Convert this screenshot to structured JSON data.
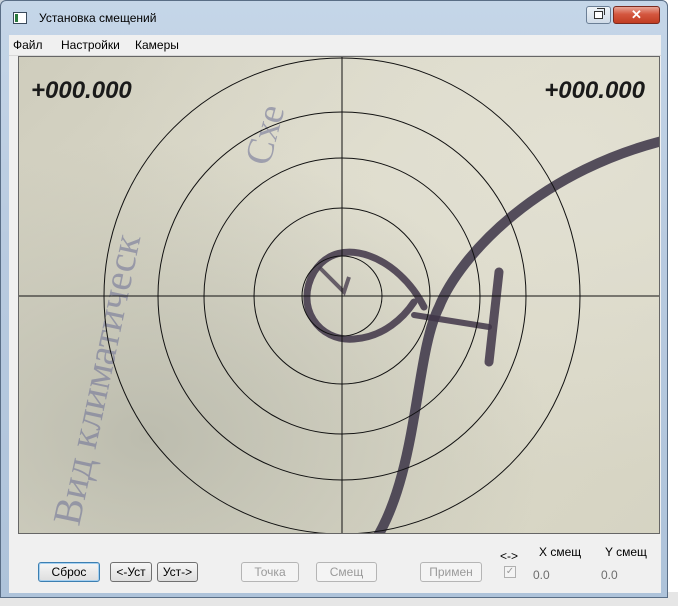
{
  "window": {
    "title": "Установка смещений",
    "close_glyph": "✕"
  },
  "menu": {
    "items": [
      "Файл",
      "Настройки",
      "Камеры"
    ]
  },
  "viewport": {
    "x_readout": "+000.000",
    "y_readout": "+000.000"
  },
  "controls": {
    "reset_label": "Сброс",
    "set_left_label": "<-Уст",
    "set_right_label": "Уст->",
    "point_label": "Точка",
    "offset_label": "Смещ",
    "apply_label": "Примен",
    "swap_label": "<->",
    "swap_checked": true,
    "x_offset_label": "X смещ",
    "y_offset_label": "Y смещ",
    "x_offset_value": "0.0",
    "y_offset_value": "0.0"
  },
  "icons": {
    "app": "app-window-icon",
    "restore": "restore-icon",
    "close": "close-icon"
  },
  "colors": {
    "close_button": "#c94a32",
    "reticle": "#111111"
  }
}
